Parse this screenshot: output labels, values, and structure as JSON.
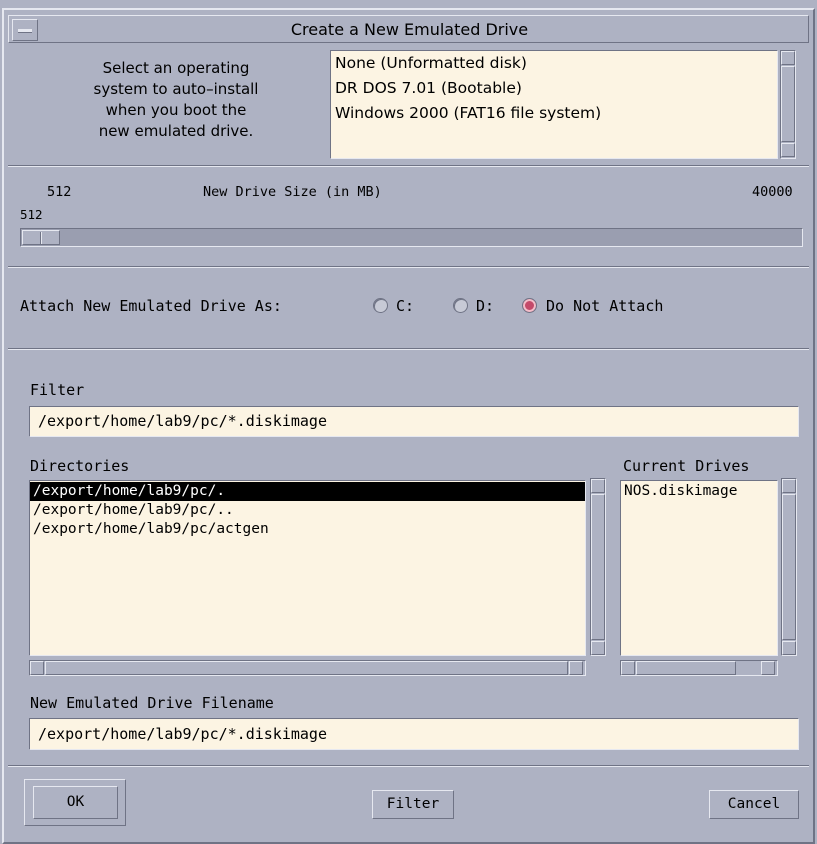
{
  "window": {
    "title": "Create a New Emulated Drive"
  },
  "os": {
    "instructions": [
      "Select an operating",
      "system to auto–install",
      "when you boot the",
      "new emulated drive."
    ],
    "options": [
      "None (Unformatted disk)",
      "DR DOS 7.01 (Bootable)",
      "Windows 2000 (FAT16 file system)"
    ]
  },
  "size": {
    "min_label": "512",
    "title": "New Drive Size (in MB)",
    "max_label": "40000",
    "value_label": "512",
    "min": 512,
    "max": 40000,
    "value": 512
  },
  "attach": {
    "label": "Attach New Emulated Drive As:",
    "options": [
      {
        "label": "C:",
        "selected": false
      },
      {
        "label": "D:",
        "selected": false
      },
      {
        "label": "Do Not Attach",
        "selected": true
      }
    ]
  },
  "filter": {
    "label": "Filter",
    "value": "/export/home/lab9/pc/*.diskimage"
  },
  "directories": {
    "label": "Directories",
    "items": [
      "/export/home/lab9/pc/.",
      "/export/home/lab9/pc/..",
      "/export/home/lab9/pc/actgen"
    ],
    "selected_index": 0
  },
  "current_drives": {
    "label": "Current Drives",
    "items": [
      "NOS.diskimage"
    ]
  },
  "filename": {
    "label": "New Emulated Drive Filename",
    "value": "/export/home/lab9/pc/*.diskimage"
  },
  "buttons": {
    "ok": "OK",
    "filter": "Filter",
    "cancel": "Cancel"
  },
  "colors": {
    "background": "#aeb2c3",
    "field": "#fcf4e3",
    "radio_selected": "#c44a6a"
  }
}
